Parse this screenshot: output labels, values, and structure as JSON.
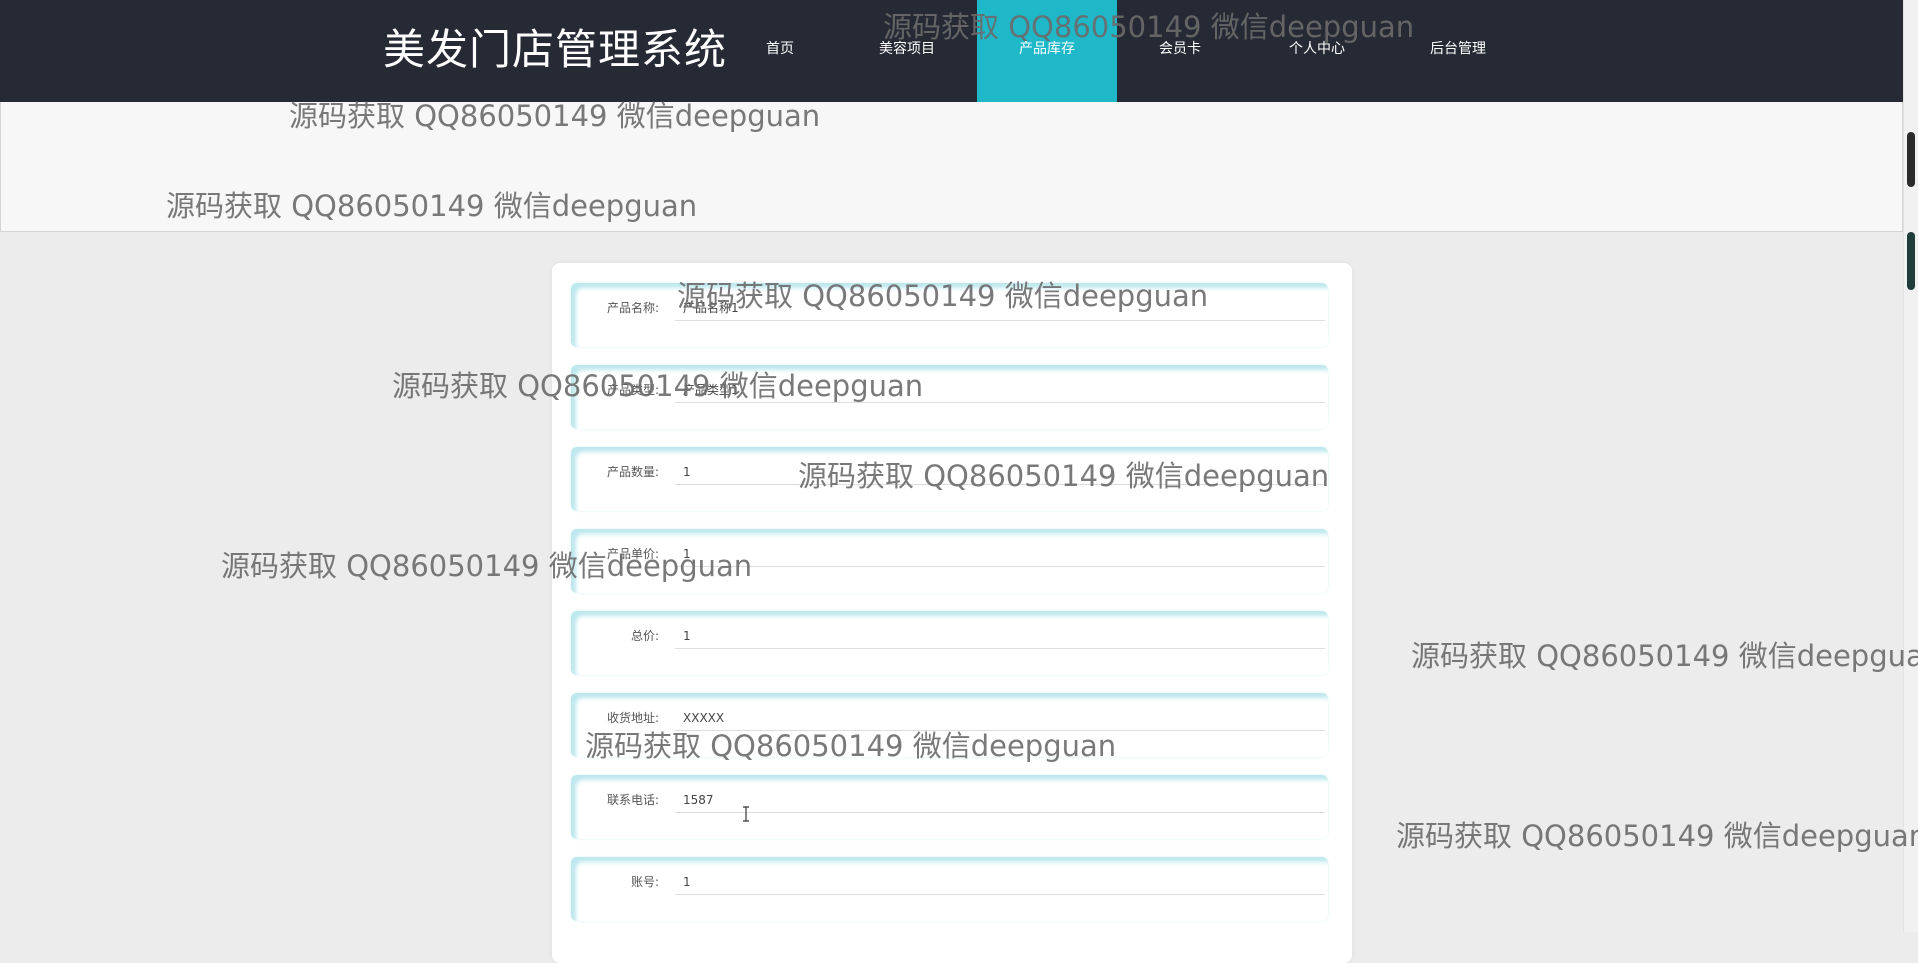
{
  "header": {
    "brand": "美发门店管理系统",
    "nav": [
      "首页",
      "美容项目",
      "产品库存",
      "会员卡",
      "个人中心",
      "后台管理"
    ],
    "active_nav": "产品库存"
  },
  "form": {
    "fields": [
      {
        "label": "产品名称:",
        "value": "产品名称1"
      },
      {
        "label": "产品类型:",
        "value": "产品类型1"
      },
      {
        "label": "产品数量:",
        "value": "1"
      },
      {
        "label": "产品单价:",
        "value": "1"
      },
      {
        "label": "总价:",
        "value": "1"
      },
      {
        "label": "收货地址:",
        "value": "XXXXX"
      },
      {
        "label": "联系电话:",
        "value": "1587"
      },
      {
        "label": "账号:",
        "value": "1"
      }
    ]
  },
  "watermark": "源码获取 QQ86050149 微信deepguan",
  "colors": {
    "header_bg": "#252a35",
    "accent": "#1fb8c9",
    "row_glow": "#bde8ee"
  }
}
